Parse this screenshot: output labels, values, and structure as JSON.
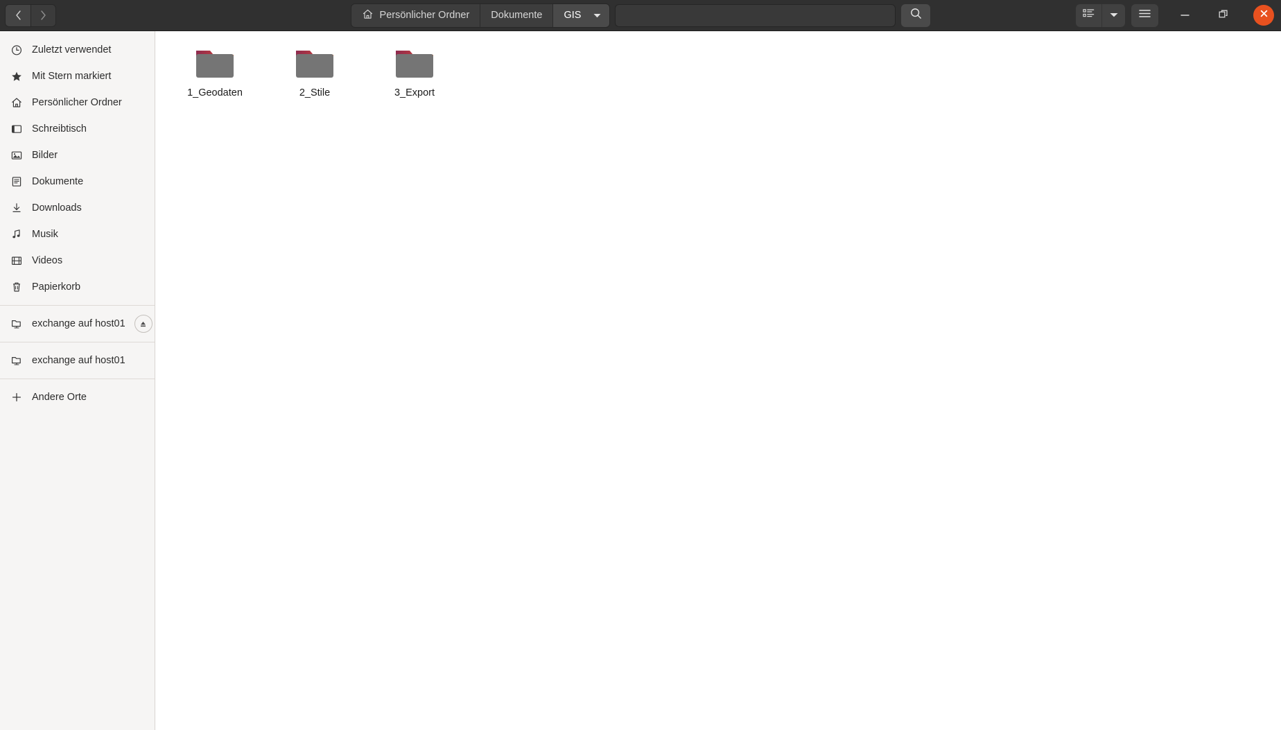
{
  "header": {
    "nav": {
      "back_tooltip": "Zurück",
      "forward_tooltip": "Vor"
    },
    "breadcrumbs": [
      {
        "label": "Persönlicher Ordner",
        "icon": "home-icon",
        "current": false
      },
      {
        "label": "Dokumente",
        "icon": "",
        "current": false
      },
      {
        "label": "GIS",
        "icon": "",
        "current": true
      }
    ],
    "path_entry_value": "",
    "path_entry_placeholder": "",
    "search_icon": "search-icon",
    "view_icon": "list-view-icon",
    "view_caret_icon": "chevron-down-icon",
    "menu_icon": "hamburger-menu-icon",
    "window_controls": {
      "minimize": "minimize-icon",
      "maximize": "restore-icon",
      "close": "close-icon",
      "close_color": "#e8511f"
    }
  },
  "sidebar": {
    "groups": [
      {
        "items": [
          {
            "label": "Zuletzt verwendet",
            "icon": "clock-icon",
            "eject": false
          },
          {
            "label": "Mit Stern markiert",
            "icon": "star-icon",
            "eject": false
          },
          {
            "label": "Persönlicher Ordner",
            "icon": "home-icon",
            "eject": false
          },
          {
            "label": "Schreibtisch",
            "icon": "desktop-icon",
            "eject": false
          },
          {
            "label": "Bilder",
            "icon": "image-icon",
            "eject": false
          },
          {
            "label": "Dokumente",
            "icon": "document-icon",
            "eject": false
          },
          {
            "label": "Downloads",
            "icon": "download-icon",
            "eject": false
          },
          {
            "label": "Musik",
            "icon": "music-note-icon",
            "eject": false
          },
          {
            "label": "Videos",
            "icon": "film-icon",
            "eject": false
          },
          {
            "label": "Papierkorb",
            "icon": "trash-icon",
            "eject": false
          }
        ]
      },
      {
        "items": [
          {
            "label": "exchange auf host01",
            "icon": "network-folder-icon",
            "eject": true
          }
        ]
      },
      {
        "items": [
          {
            "label": "exchange auf host01",
            "icon": "network-folder-icon",
            "eject": false
          }
        ]
      },
      {
        "items": [
          {
            "label": "Andere Orte",
            "icon": "plus-icon",
            "eject": false
          }
        ]
      }
    ]
  },
  "main": {
    "files": [
      {
        "name": "1_Geodaten",
        "icon": "folder-icon"
      },
      {
        "name": "2_Stile",
        "icon": "folder-icon"
      },
      {
        "name": "3_Export",
        "icon": "folder-icon"
      }
    ]
  },
  "colors": {
    "headerbar": "#303030",
    "sidebar": "#f6f5f4",
    "content": "#ffffff",
    "folder_body": "#757575",
    "folder_tab_start": "#8e2a4e",
    "folder_tab_end": "#e8622a",
    "accent": "#e8511f"
  }
}
